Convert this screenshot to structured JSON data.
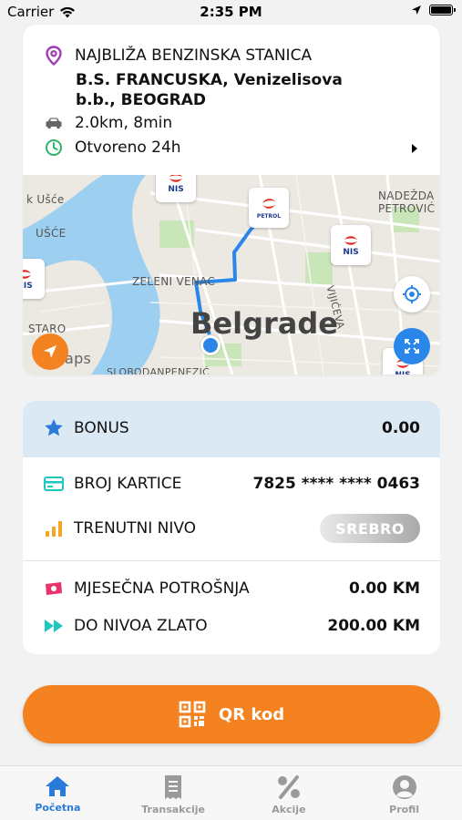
{
  "status_bar": {
    "carrier": "Carrier",
    "time": "2:35 PM"
  },
  "station": {
    "header": "NAJBLIŽA BENZINSKA STANICA",
    "name": "B.S. FRANCUSKA, Venizelisova b.b., BEOGRAD",
    "distance": "2.0km, 8min",
    "hours": "Otvoreno 24h"
  },
  "map": {
    "city": "Belgrade",
    "labels": {
      "usce_top": "k Ušće",
      "usce": "UŠĆE",
      "zeleni_venac": "ZELENI VENAC",
      "nadezda": "NADEŽDA",
      "petrovic": "PETROVIĆ",
      "vijiceva": "VIJIĆEVA",
      "staro": "STARO",
      "maps": "aps",
      "slobodanpenezic": "SLOBODANPENEZIĆ"
    },
    "marker_brand": "NIS"
  },
  "loyalty": {
    "bonus_label": "BONUS",
    "bonus_value": "0.00",
    "card_label": "BROJ KARTICE",
    "card_value": "7825 **** **** 0463",
    "level_label": "TRENUTNI NIVO",
    "level_value": "SREBRO",
    "monthly_label": "MJESEČNA POTROŠNJA",
    "monthly_value": "0.00 KM",
    "gold_label": "DO NIVOA ZLATO",
    "gold_value": "200.00 KM"
  },
  "qr_button": {
    "label": "QR kod"
  },
  "tabs": [
    {
      "label": "Početna",
      "icon": "home-icon",
      "active": true
    },
    {
      "label": "Transakcije",
      "icon": "receipt-icon",
      "active": false
    },
    {
      "label": "Akcije",
      "icon": "percent-icon",
      "active": false
    },
    {
      "label": "Profil",
      "icon": "profile-icon",
      "active": false
    }
  ],
  "colors": {
    "accent_orange": "#f58220",
    "accent_blue": "#2a7bd9",
    "bonus_bg": "#dbe9f5",
    "purple_pin": "#a33ab8",
    "green_clock": "#2fb56a"
  }
}
